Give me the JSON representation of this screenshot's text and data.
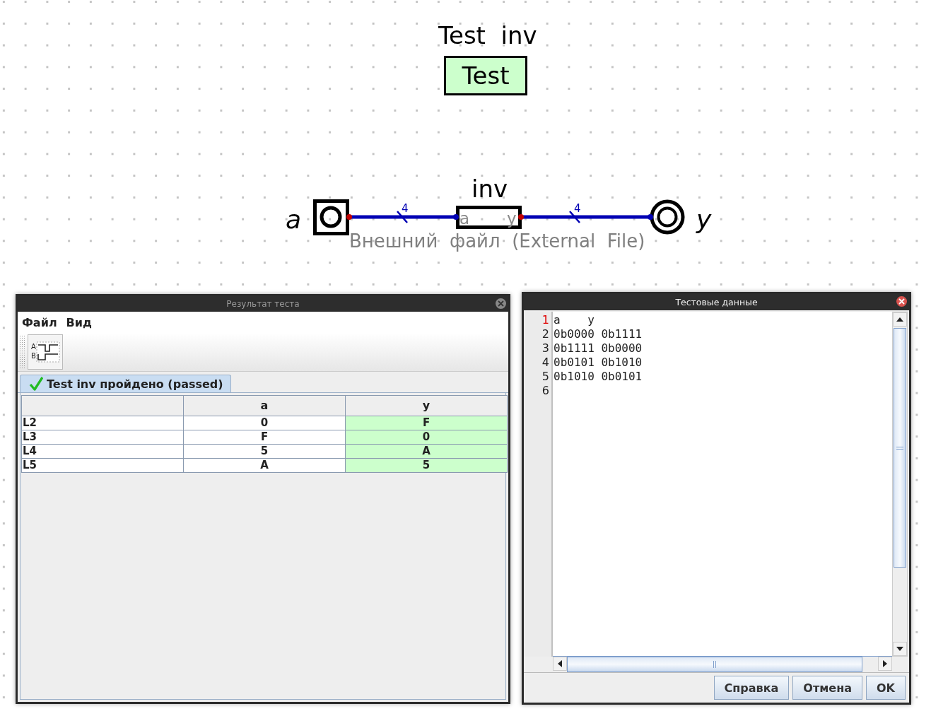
{
  "canvas": {
    "test_title": "Test  inv",
    "test_button": "Test",
    "component": {
      "label": "inv",
      "pin_in": "a",
      "pin_out": "y",
      "description": "Внешний  файл  (External  File)"
    },
    "input": {
      "label": "a",
      "bits": "4"
    },
    "output": {
      "label": "y",
      "bits": "4"
    }
  },
  "result_window": {
    "title": "Результат теста",
    "menu": [
      "Файл",
      "Вид"
    ],
    "toolbar": {
      "signal_labels": [
        "A",
        "B"
      ]
    },
    "tab": {
      "label": "Test inv пройдено (passed)",
      "selected": true
    },
    "table": {
      "columns": [
        "a",
        "y"
      ],
      "rows": [
        {
          "label": "L2",
          "cells": [
            {
              "value": "0",
              "passed": false
            },
            {
              "value": "F",
              "passed": true
            }
          ]
        },
        {
          "label": "L3",
          "cells": [
            {
              "value": "F",
              "passed": false
            },
            {
              "value": "0",
              "passed": true
            }
          ]
        },
        {
          "label": "L4",
          "cells": [
            {
              "value": "5",
              "passed": false
            },
            {
              "value": "A",
              "passed": true
            }
          ]
        },
        {
          "label": "L5",
          "cells": [
            {
              "value": "A",
              "passed": false
            },
            {
              "value": "5",
              "passed": true
            }
          ]
        }
      ]
    }
  },
  "data_window": {
    "title": "Тестовые данные",
    "lines": [
      {
        "number": "1",
        "text": "a    y",
        "current": true
      },
      {
        "number": "2",
        "text": "0b0000 0b1111",
        "current": false
      },
      {
        "number": "3",
        "text": "0b1111 0b0000",
        "current": false
      },
      {
        "number": "4",
        "text": "0b0101 0b1010",
        "current": false
      },
      {
        "number": "5",
        "text": "0b1010 0b0101",
        "current": false
      },
      {
        "number": "6",
        "current": false
      }
    ],
    "buttons": [
      "Справка",
      "Отмена",
      "OK"
    ]
  }
}
